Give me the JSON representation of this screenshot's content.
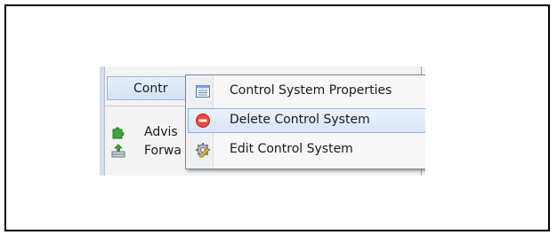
{
  "panel": {
    "selected_row_label": "Contr",
    "rows": [
      {
        "label": "Advis",
        "icon": "puzzle-icon"
      },
      {
        "label": "Forwa",
        "icon": "outbox-icon"
      }
    ]
  },
  "context_menu": {
    "items": [
      {
        "label": "Control System Properties",
        "icon": "properties-icon"
      },
      {
        "label": "Delete Control System",
        "icon": "delete-icon",
        "hovered": true
      },
      {
        "label": "Edit Control System",
        "icon": "edit-gear-icon"
      }
    ]
  },
  "colors": {
    "delete_red": "#d9332a",
    "puzzle_green": "#3aa53a",
    "menu_hover": "#d6e5f7"
  }
}
